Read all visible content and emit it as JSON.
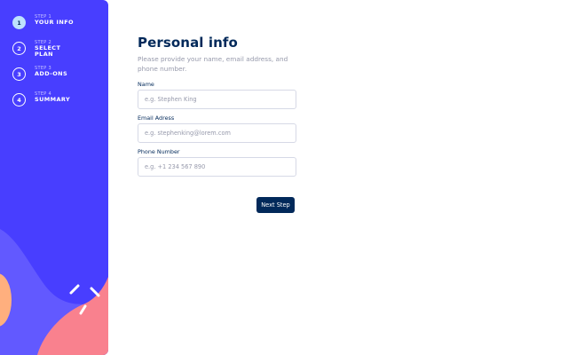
{
  "sidebar": {
    "steps": [
      {
        "number": "1",
        "caption": "STEP 1",
        "title": "YOUR INFO"
      },
      {
        "number": "2",
        "caption": "STEP 2",
        "title": "SELECT\nPLAN"
      },
      {
        "number": "3",
        "caption": "STEP 3",
        "title": "ADD-ONS"
      },
      {
        "number": "4",
        "caption": "STEP 4",
        "title": "SUMMARY"
      }
    ],
    "active_step": 1
  },
  "form": {
    "title": "Personal info",
    "subtitle": "Please provide your name, email address, and phone number.",
    "fields": {
      "name": {
        "label": "Name",
        "placeholder": "e.g. Stephen King",
        "value": ""
      },
      "email": {
        "label": "Email Adress",
        "placeholder": "e.g. stephenking@lorem.com",
        "value": ""
      },
      "phone": {
        "label": "Phone Number",
        "placeholder": "e.g. +1 234 567 890",
        "value": ""
      }
    },
    "next_button": "Next Step"
  },
  "colors": {
    "sidebar_bg": "#483eff",
    "active_step": "#bee2fd",
    "denim": "#02295a",
    "coral": "#f9818e",
    "orange": "#ffaf7e",
    "purple_blob": "#6259ff",
    "border": "#d6d9e6",
    "muted": "#9699ab"
  }
}
